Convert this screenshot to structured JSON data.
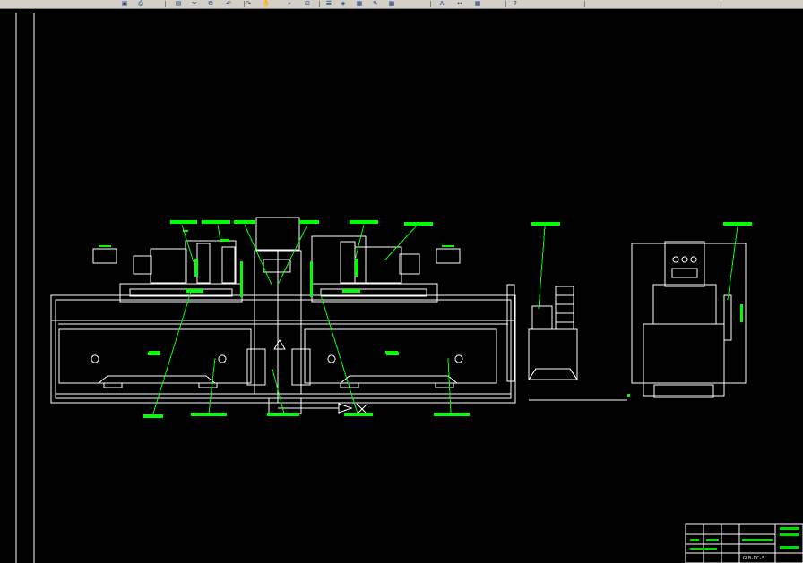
{
  "app": {
    "toolbar": {
      "buttons": [
        {
          "name": "print-preview-button",
          "icon": "print-preview-icon",
          "glyph": "▣"
        },
        {
          "name": "plot-button",
          "icon": "plot-icon",
          "glyph": "⎙"
        },
        {
          "name": "layer-button",
          "icon": "layer-icon",
          "glyph": "▤"
        },
        {
          "name": "cut-button",
          "icon": "cut-icon",
          "glyph": "✂"
        },
        {
          "name": "copy-button",
          "icon": "copy-icon",
          "glyph": "⧉"
        },
        {
          "name": "undo-button",
          "icon": "undo-icon",
          "glyph": "↶"
        },
        {
          "name": "redo-button",
          "icon": "redo-icon",
          "glyph": "↷"
        },
        {
          "name": "pan-button",
          "icon": "pan-icon",
          "glyph": "✋"
        },
        {
          "name": "zoom-button",
          "icon": "zoom-icon",
          "glyph": "⌕"
        },
        {
          "name": "zoom-window-button",
          "icon": "zoom-window-icon",
          "glyph": "⊡"
        },
        {
          "name": "properties-button",
          "icon": "properties-icon",
          "glyph": "☰"
        },
        {
          "name": "design-center-button",
          "icon": "design-center-icon",
          "glyph": "◈"
        },
        {
          "name": "tool-palette-button",
          "icon": "tool-palette-icon",
          "glyph": "▦"
        },
        {
          "name": "markup-button",
          "icon": "markup-icon",
          "glyph": "✎"
        },
        {
          "name": "calculator-button",
          "icon": "calculator-icon",
          "glyph": "▩"
        },
        {
          "name": "text-style-button",
          "icon": "text-style-icon",
          "glyph": "A"
        },
        {
          "name": "dim-style-button",
          "icon": "dim-style-icon",
          "glyph": "↔"
        },
        {
          "name": "table-style-button",
          "icon": "table-style-icon",
          "glyph": "▦"
        },
        {
          "name": "help-button",
          "icon": "help-icon",
          "glyph": "?"
        }
      ]
    },
    "colors": {
      "background": "#000000",
      "outline": "#ffffff",
      "callout": "#00ff00",
      "label_block": "#00dd00",
      "toolbar": "#d4d0c8"
    },
    "title_block": {
      "drawing_code": "GLB-DC-5"
    }
  }
}
